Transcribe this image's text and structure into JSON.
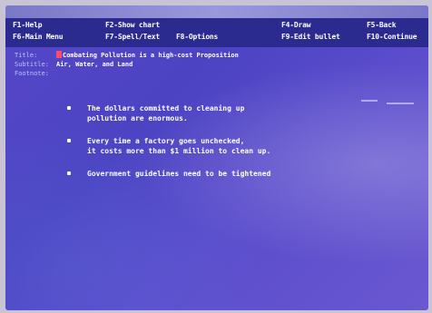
{
  "function_keys": [
    {
      "key": "F1",
      "label": "F1-Help"
    },
    {
      "key": "F2",
      "label": "F2-Show chart"
    },
    {
      "key": "F4",
      "label": "F4-Draw"
    },
    {
      "key": "F5",
      "label": "F5-Back"
    },
    {
      "key": "F6",
      "label": "F6-Main Menu"
    },
    {
      "key": "F7",
      "label": "F7-Spell/Text"
    },
    {
      "key": "F8",
      "label": "F8-Options"
    },
    {
      "key": "F9",
      "label": "F9-Edit bullet"
    },
    {
      "key": "F10",
      "label": "F10-Continue"
    }
  ],
  "fields": {
    "title_label": "Title:",
    "title_value": "Combating Pollution is a high-cost Proposition",
    "subtitle_label": "Subtitle:",
    "subtitle_value": "Air, Water, and Land",
    "footnote_label": "Footnote:",
    "footnote_value": ""
  },
  "bullets": [
    {
      "lines": [
        "The dollars committed to cleaning up",
        "pollution are enormous."
      ]
    },
    {
      "lines": [
        "Every time a factory goes unchecked,",
        "it costs more than $1 million to clean up."
      ]
    },
    {
      "lines": [
        "Government guidelines need to be tightened"
      ]
    }
  ],
  "colors": {
    "screen_bg": "#4b43c2",
    "menu_bar": "#2a2a8f",
    "cursor": "#ff4a6a"
  }
}
